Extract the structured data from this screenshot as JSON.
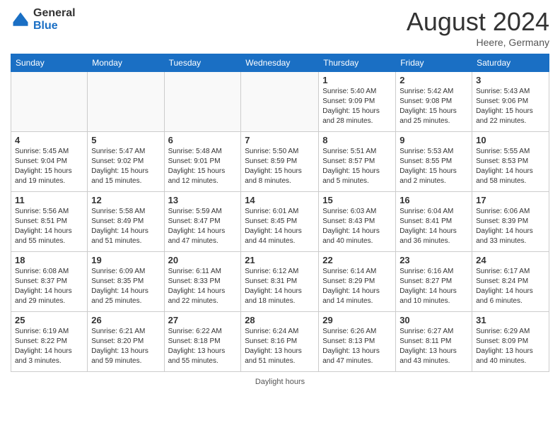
{
  "header": {
    "logo_general": "General",
    "logo_blue": "Blue",
    "month_year": "August 2024",
    "location": "Heere, Germany"
  },
  "weekdays": [
    "Sunday",
    "Monday",
    "Tuesday",
    "Wednesday",
    "Thursday",
    "Friday",
    "Saturday"
  ],
  "weeks": [
    [
      {
        "day": "",
        "info": ""
      },
      {
        "day": "",
        "info": ""
      },
      {
        "day": "",
        "info": ""
      },
      {
        "day": "",
        "info": ""
      },
      {
        "day": "1",
        "info": "Sunrise: 5:40 AM\nSunset: 9:09 PM\nDaylight: 15 hours and 28 minutes."
      },
      {
        "day": "2",
        "info": "Sunrise: 5:42 AM\nSunset: 9:08 PM\nDaylight: 15 hours and 25 minutes."
      },
      {
        "day": "3",
        "info": "Sunrise: 5:43 AM\nSunset: 9:06 PM\nDaylight: 15 hours and 22 minutes."
      }
    ],
    [
      {
        "day": "4",
        "info": "Sunrise: 5:45 AM\nSunset: 9:04 PM\nDaylight: 15 hours and 19 minutes."
      },
      {
        "day": "5",
        "info": "Sunrise: 5:47 AM\nSunset: 9:02 PM\nDaylight: 15 hours and 15 minutes."
      },
      {
        "day": "6",
        "info": "Sunrise: 5:48 AM\nSunset: 9:01 PM\nDaylight: 15 hours and 12 minutes."
      },
      {
        "day": "7",
        "info": "Sunrise: 5:50 AM\nSunset: 8:59 PM\nDaylight: 15 hours and 8 minutes."
      },
      {
        "day": "8",
        "info": "Sunrise: 5:51 AM\nSunset: 8:57 PM\nDaylight: 15 hours and 5 minutes."
      },
      {
        "day": "9",
        "info": "Sunrise: 5:53 AM\nSunset: 8:55 PM\nDaylight: 15 hours and 2 minutes."
      },
      {
        "day": "10",
        "info": "Sunrise: 5:55 AM\nSunset: 8:53 PM\nDaylight: 14 hours and 58 minutes."
      }
    ],
    [
      {
        "day": "11",
        "info": "Sunrise: 5:56 AM\nSunset: 8:51 PM\nDaylight: 14 hours and 55 minutes."
      },
      {
        "day": "12",
        "info": "Sunrise: 5:58 AM\nSunset: 8:49 PM\nDaylight: 14 hours and 51 minutes."
      },
      {
        "day": "13",
        "info": "Sunrise: 5:59 AM\nSunset: 8:47 PM\nDaylight: 14 hours and 47 minutes."
      },
      {
        "day": "14",
        "info": "Sunrise: 6:01 AM\nSunset: 8:45 PM\nDaylight: 14 hours and 44 minutes."
      },
      {
        "day": "15",
        "info": "Sunrise: 6:03 AM\nSunset: 8:43 PM\nDaylight: 14 hours and 40 minutes."
      },
      {
        "day": "16",
        "info": "Sunrise: 6:04 AM\nSunset: 8:41 PM\nDaylight: 14 hours and 36 minutes."
      },
      {
        "day": "17",
        "info": "Sunrise: 6:06 AM\nSunset: 8:39 PM\nDaylight: 14 hours and 33 minutes."
      }
    ],
    [
      {
        "day": "18",
        "info": "Sunrise: 6:08 AM\nSunset: 8:37 PM\nDaylight: 14 hours and 29 minutes."
      },
      {
        "day": "19",
        "info": "Sunrise: 6:09 AM\nSunset: 8:35 PM\nDaylight: 14 hours and 25 minutes."
      },
      {
        "day": "20",
        "info": "Sunrise: 6:11 AM\nSunset: 8:33 PM\nDaylight: 14 hours and 22 minutes."
      },
      {
        "day": "21",
        "info": "Sunrise: 6:12 AM\nSunset: 8:31 PM\nDaylight: 14 hours and 18 minutes."
      },
      {
        "day": "22",
        "info": "Sunrise: 6:14 AM\nSunset: 8:29 PM\nDaylight: 14 hours and 14 minutes."
      },
      {
        "day": "23",
        "info": "Sunrise: 6:16 AM\nSunset: 8:27 PM\nDaylight: 14 hours and 10 minutes."
      },
      {
        "day": "24",
        "info": "Sunrise: 6:17 AM\nSunset: 8:24 PM\nDaylight: 14 hours and 6 minutes."
      }
    ],
    [
      {
        "day": "25",
        "info": "Sunrise: 6:19 AM\nSunset: 8:22 PM\nDaylight: 14 hours and 3 minutes."
      },
      {
        "day": "26",
        "info": "Sunrise: 6:21 AM\nSunset: 8:20 PM\nDaylight: 13 hours and 59 minutes."
      },
      {
        "day": "27",
        "info": "Sunrise: 6:22 AM\nSunset: 8:18 PM\nDaylight: 13 hours and 55 minutes."
      },
      {
        "day": "28",
        "info": "Sunrise: 6:24 AM\nSunset: 8:16 PM\nDaylight: 13 hours and 51 minutes."
      },
      {
        "day": "29",
        "info": "Sunrise: 6:26 AM\nSunset: 8:13 PM\nDaylight: 13 hours and 47 minutes."
      },
      {
        "day": "30",
        "info": "Sunrise: 6:27 AM\nSunset: 8:11 PM\nDaylight: 13 hours and 43 minutes."
      },
      {
        "day": "31",
        "info": "Sunrise: 6:29 AM\nSunset: 8:09 PM\nDaylight: 13 hours and 40 minutes."
      }
    ]
  ],
  "footer": {
    "daylight_label": "Daylight hours"
  }
}
